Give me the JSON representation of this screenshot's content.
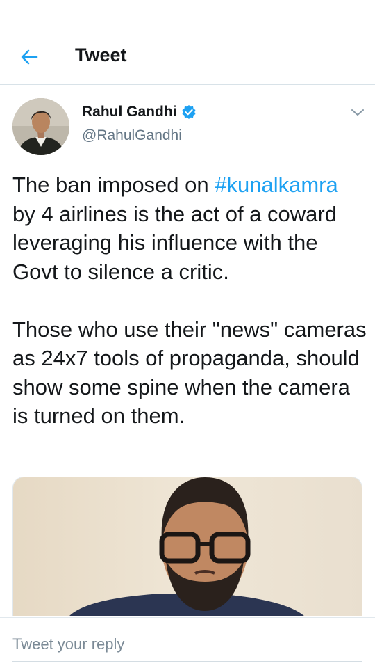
{
  "header": {
    "title": "Tweet",
    "back_icon": "arrow-left-icon",
    "accent_color": "#1da1f2"
  },
  "tweet": {
    "author": {
      "display_name": "Rahul Gandhi",
      "handle": "@RahulGandhi",
      "verified": true,
      "verified_icon": "verified-badge-icon"
    },
    "text": {
      "line1_before": "The ban imposed on ",
      "hashtag": "#kunalkamra",
      "line1_after": " by 4 airlines is the act of a coward leveraging his influence with the Govt to silence a critic.",
      "paragraph2": "Those who use their \"news\" cameras as 24x7 tools of propaganda, should show some spine when the camera is turned on them."
    },
    "media": {
      "type": "photo"
    }
  },
  "reply": {
    "placeholder": "Tweet your reply"
  }
}
